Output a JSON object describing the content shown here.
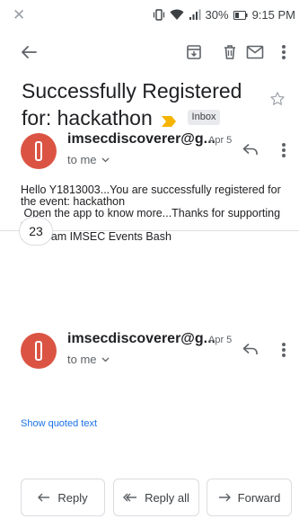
{
  "status_bar": {
    "battery_percent": "30%",
    "time": "9:15 PM"
  },
  "toolbar": {
    "icons": [
      "back-arrow-icon",
      "archive-icon",
      "delete-icon",
      "mark-unread-icon",
      "more-vert-icon"
    ]
  },
  "email": {
    "subject": "Successfully Registered for: hackathon",
    "label": "Inbox"
  },
  "messages": [
    {
      "sender": "imsecdiscoverer@g...",
      "date": "Apr 5",
      "recipient": "to me",
      "body": [
        "Hello Y1813003...You are successfully registered for the event: hackathon",
        " Open the app to know more...Thanks for supporting us",
        "..... Team IMSEC Events Bash"
      ]
    },
    {
      "sender": "imsecdiscoverer@g...",
      "date": "Apr 5",
      "recipient": "to me"
    }
  ],
  "collapsed_count": "23",
  "show_quoted_text": "Show quoted text",
  "actions": {
    "reply": "Reply",
    "reply_all": "Reply all",
    "forward": "Forward"
  },
  "colors": {
    "avatar": "#db5443",
    "label_icon": "#f4b400",
    "link": "#1a73e8"
  }
}
